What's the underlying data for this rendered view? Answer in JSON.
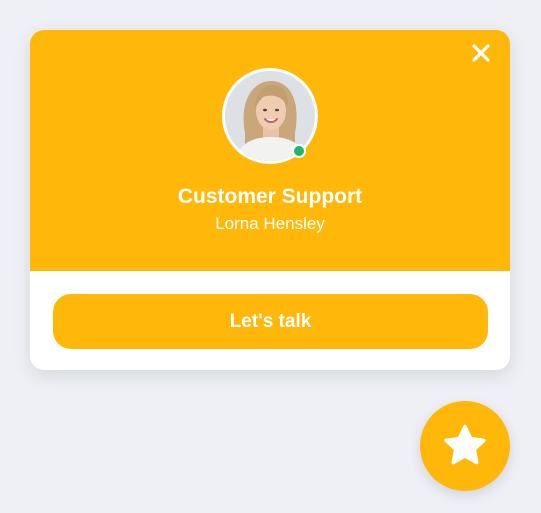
{
  "widget": {
    "role": "Customer Support",
    "agent_name": "Lorna Hensley",
    "cta_label": "Let's talk",
    "status": "online"
  },
  "icons": {
    "close": "close-icon",
    "launcher": "star-icon"
  },
  "colors": {
    "accent": "#ffb70a",
    "online": "#1bb86a",
    "page_bg": "#eef0f5",
    "card_bg": "#ffffff"
  }
}
